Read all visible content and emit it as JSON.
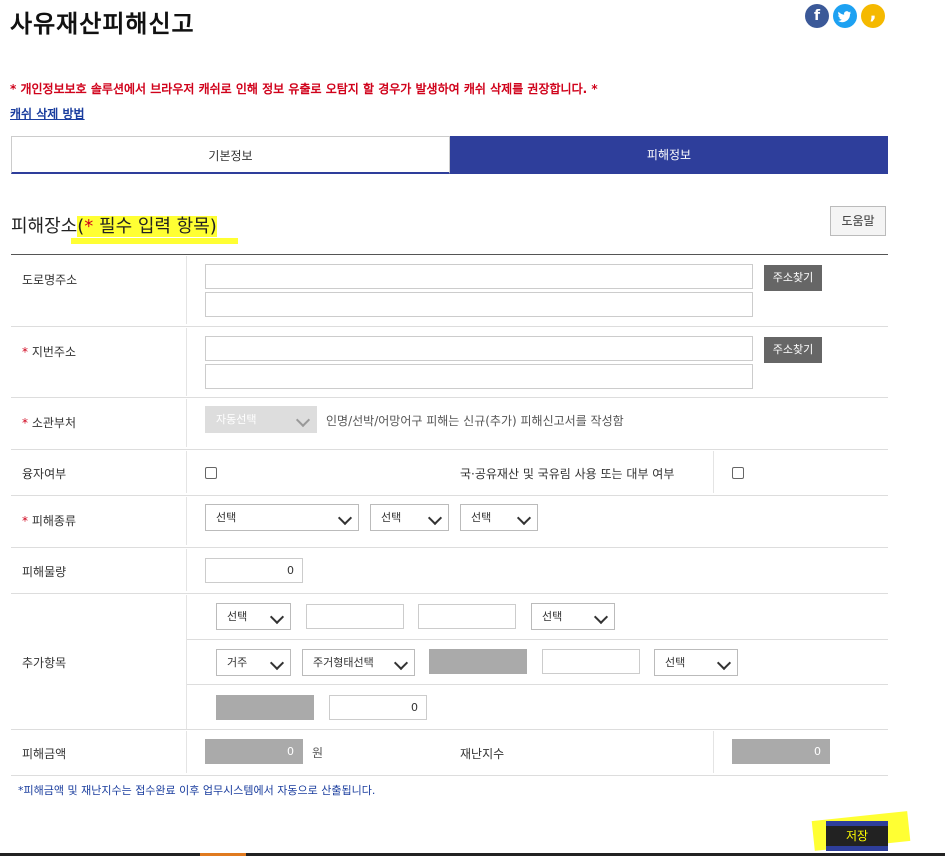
{
  "page": {
    "title": "사유재산피해신고",
    "notice": "* 개인정보보호 솔루션에서 브라우저 캐쉬로 인해 정보 유출로 오탐지 할 경우가 발생하여 캐쉬 삭제를 권장합니다. *",
    "cache_link": "캐쉬 삭제 방법"
  },
  "social": {
    "facebook": "f",
    "twitter": "t",
    "kakao": ","
  },
  "tabs": [
    {
      "label": "기본정보",
      "active": false
    },
    {
      "label": "피해정보",
      "active": true
    }
  ],
  "section": {
    "title": "피해장소",
    "required_note_open": "(",
    "required_star": "*",
    "required_note": " 필수 입력 항목)",
    "help_button": "도움말"
  },
  "form": {
    "road_address_label": "도로명주소",
    "lot_address_label": "지번주소",
    "find_address_button": "주소찾기",
    "department_label": "소관부처",
    "department_select": "자동선택",
    "department_hint": "인명/선박/어망어구 피해는 신규(추가) 피해신고서를 작성함",
    "loan_label": "융자여부",
    "public_use_label": "국·공유재산 및 국유림 사용 또는 대부 여부",
    "damage_type_label": "피해종류",
    "select_placeholder": "선택",
    "damage_amount_label": "피해물량",
    "damage_amount_value": "0",
    "additional_label": "추가항목",
    "add_row1": {
      "select1": "선택",
      "select4": "선택"
    },
    "add_row2": {
      "select1": "거주",
      "select2": "주거형태선택",
      "select5": "선택"
    },
    "add_row3": {
      "value": "0"
    },
    "cost_label": "피해금액",
    "cost_value": "0",
    "cost_unit": "원",
    "disaster_index_label": "재난지수",
    "disaster_index_value": "0",
    "footnote": "*피해금액 및 재난지수는 접수완료 이후 업무시스템에서 자동으로 산출됩니다.",
    "save_button": "저장"
  },
  "colors": {
    "primary": "#2e3e9b",
    "required": "#d0021b",
    "highlight": "#ffff33"
  },
  "required": "*"
}
